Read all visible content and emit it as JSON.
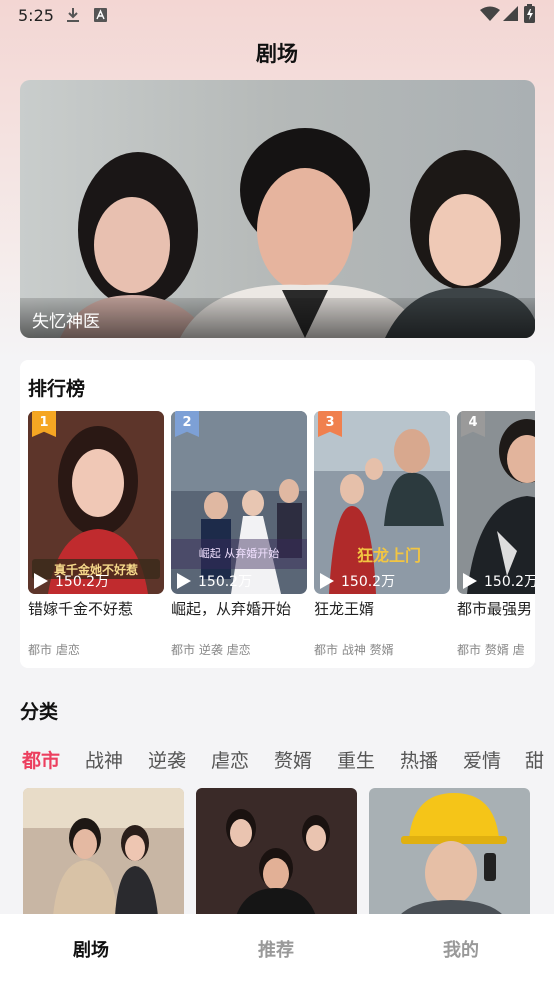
{
  "status_bar": {
    "time": "5:25",
    "icons": [
      "download-icon",
      "a-badge-icon",
      "wifi-icon",
      "signal-icon",
      "battery-icon"
    ]
  },
  "page_title": "剧场",
  "banner": {
    "caption": "失忆神医"
  },
  "ranking": {
    "title": "排行榜",
    "items": [
      {
        "rank": "1",
        "badge_color": "#f5a623",
        "plays": "150.2万",
        "name": "错嫁千金不好惹",
        "tags": "都市 虐恋",
        "poster_text": "真千金她不好惹"
      },
      {
        "rank": "2",
        "badge_color": "#7da0d6",
        "plays": "150.2万",
        "name": "崛起，从弃婚开始",
        "tags": "都市 逆袭 虐恋",
        "poster_text": "崛起 从弃婚开始"
      },
      {
        "rank": "3",
        "badge_color": "#f0804e",
        "plays": "150.2万",
        "name": "狂龙王婿",
        "tags": "都市 战神 赘婿",
        "poster_text": "狂龙上门"
      },
      {
        "rank": "4",
        "badge_color": "#9a9a9a",
        "plays": "150.2万",
        "name": "都市最强男",
        "tags": "都市 赘婿 虐",
        "poster_text": ""
      }
    ]
  },
  "category": {
    "title": "分类",
    "tabs": [
      "都市",
      "战神",
      "逆袭",
      "虐恋",
      "赘婿",
      "重生",
      "热播",
      "爱情",
      "甜"
    ],
    "active_index": 0,
    "accent": "#ec3f5f"
  },
  "bottom_nav": {
    "items": [
      "剧场",
      "推荐",
      "我的"
    ],
    "active_index": 0
  }
}
